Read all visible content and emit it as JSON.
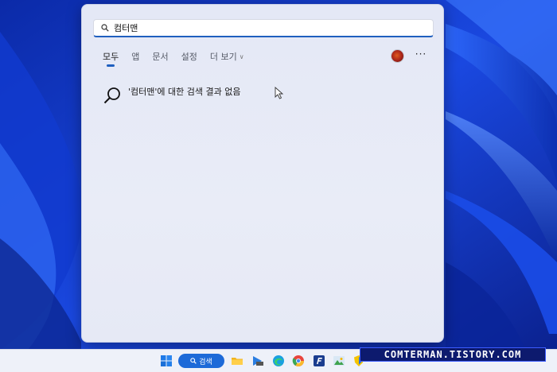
{
  "search": {
    "query": "컴터맨",
    "icon": "search-icon"
  },
  "tabs": [
    {
      "label": "모두",
      "active": true
    },
    {
      "label": "앱",
      "active": false
    },
    {
      "label": "문서",
      "active": false
    },
    {
      "label": "설정",
      "active": false
    },
    {
      "label": "더 보기",
      "active": false
    }
  ],
  "more_label": "···",
  "no_result": {
    "message": "'컴터맨'에 대한 검색 결과 없음",
    "icon": "search-icon"
  },
  "taskbar": {
    "search_label": "검색",
    "apps": [
      "windows-start-icon",
      "file-explorer-icon",
      "media-icon",
      "edge-icon",
      "chrome-icon",
      "f-app-icon",
      "photo-app-icon",
      "shield-app-icon"
    ]
  },
  "watermark": "COMTERMAN.TISTORY.COM",
  "colors": {
    "accent": "#1f5fbf",
    "wallpaper": "#0a2fb8",
    "taskbar_search": "#1d6ad8"
  }
}
